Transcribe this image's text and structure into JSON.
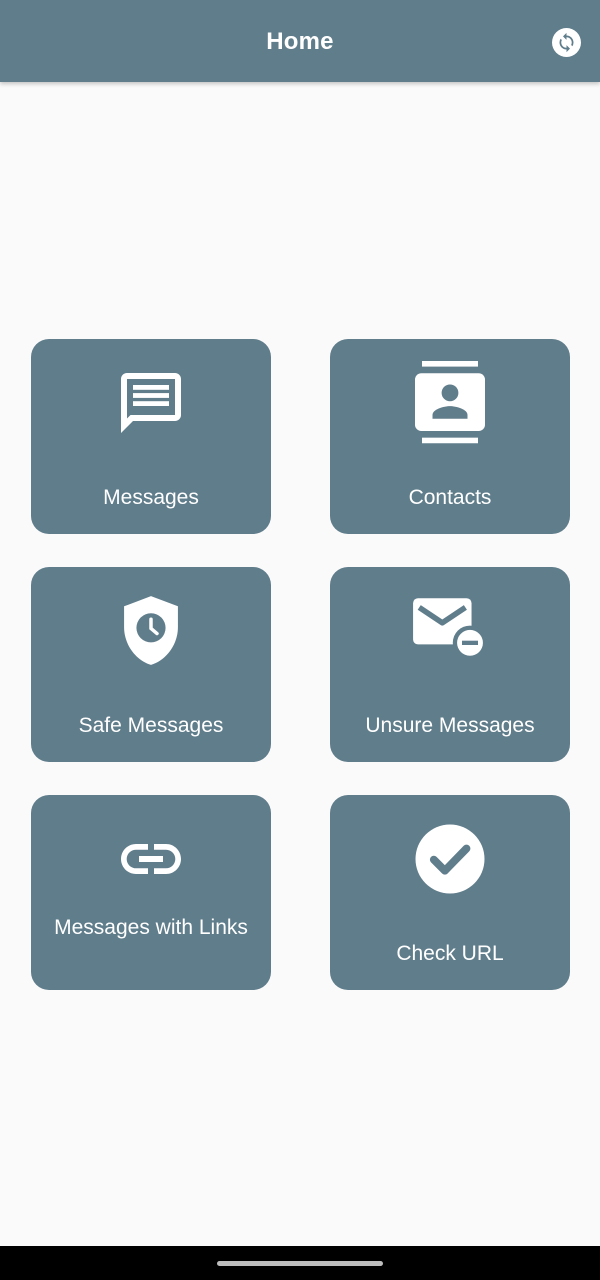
{
  "app_bar": {
    "title": "Home",
    "refresh_icon": "refresh-icon",
    "color": "#607d8b"
  },
  "tiles": [
    {
      "label": "Messages",
      "icon": "message-icon"
    },
    {
      "label": "Contacts",
      "icon": "contacts-icon"
    },
    {
      "label": "Safe Messages",
      "icon": "shield-clock-icon"
    },
    {
      "label": "Unsure Messages",
      "icon": "mail-minus-icon"
    },
    {
      "label": "Messages with Links",
      "icon": "link-icon"
    },
    {
      "label": "Check URL",
      "icon": "check-circle-icon"
    }
  ],
  "colors": {
    "tile": "#607d8b",
    "background": "#fafafa",
    "text": "#ffffff"
  }
}
